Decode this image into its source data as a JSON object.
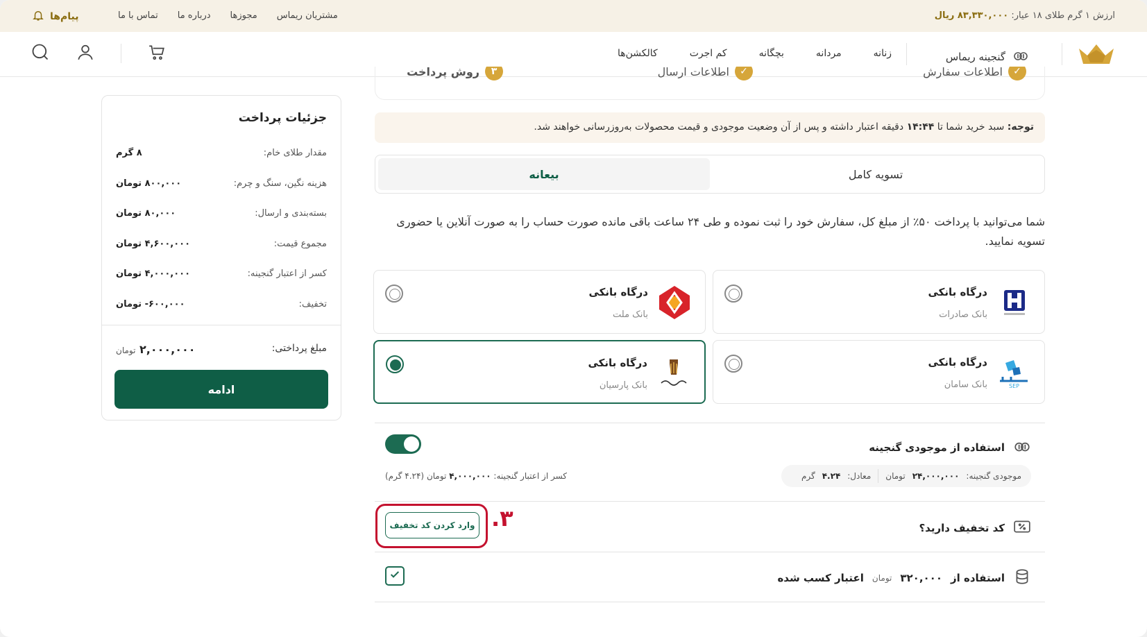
{
  "topbar": {
    "gold_label": "ارزش ۱ گرم طلای ۱۸ عیار:",
    "gold_value": "۸۳,۳۳۰,۰۰۰ ریال",
    "links": [
      "مشتریان ریماس",
      "مجوزها",
      "درباره ما",
      "تماس با ما"
    ],
    "messages": "پیام‌ها"
  },
  "header": {
    "treasury": "گنجینه ریماس",
    "nav": [
      "زنانه",
      "مردانه",
      "بچگانه",
      "کم اجرت",
      "کالکشن‌ها"
    ]
  },
  "steps": [
    {
      "label": "اطلاعات سفارش"
    },
    {
      "label": "اطلاعات ارسال"
    },
    {
      "num": "۳",
      "label": "روش پرداخت"
    }
  ],
  "notice": {
    "lead": "توجه:",
    "text_a": " سبد خرید شما تا ",
    "time": "۱۴:۴۴",
    "text_b": " دقیقه اعتبار داشته و پس از آن وضعیت موجودی و قیمت محصولات به‌روزرسانی خواهند شد."
  },
  "tabs": {
    "full": "تسویه کامل",
    "deposit": "بیعانه"
  },
  "description": "شما می‌توانید با پرداخت ۵۰٪ از  مبلغ کل، سفارش خود را ثبت نموده و طی ۲۴ ساعت باقی مانده صورت حساب را به صورت  آنلاین یا حضوری تسویه نمایید.",
  "gateways": [
    {
      "title": "درگاه بانکی",
      "bank": "بانک صادرات",
      "selected": false
    },
    {
      "title": "درگاه بانکی",
      "bank": "بانک ملت",
      "selected": false
    },
    {
      "title": "درگاه بانکی",
      "bank": "بانک سامان",
      "selected": false
    },
    {
      "title": "درگاه بانکی",
      "bank": "بانک پارسیان",
      "selected": true
    }
  ],
  "treasury_use": {
    "title": "استفاده از موجودی گنجینه",
    "balance_label": "موجودی گنجینه:",
    "balance_value": "۲۴,۰۰۰,۰۰۰",
    "balance_unit": "تومان",
    "equiv_label": "معادل:",
    "equiv_value": "۴.۲۴",
    "equiv_unit": "گرم",
    "deduct_label": "کسر از اعتبار گنجینه:",
    "deduct_value": "۴,۰۰۰,۰۰۰",
    "deduct_unit": "تومان",
    "deduct_grams": "(۴.۲۴ گرم)",
    "enabled": true
  },
  "coupon": {
    "question": "کد تخفیف دارید؟",
    "button": "وارد کردن کد تخفیف",
    "marker": "۳."
  },
  "credit": {
    "prefix": "استفاده از",
    "amount": "۳۲۰,۰۰۰",
    "unit": "تومان",
    "suffix": "اعتبار کسب شده",
    "checked": true
  },
  "summary": {
    "title": "جزئیات پرداخت",
    "rows": [
      {
        "label": "مقدار طلای خام:",
        "value": "۸ گرم"
      },
      {
        "label": "هزینه نگین، سنگ و چرم:",
        "value": "۸۰۰,۰۰۰ تومان"
      },
      {
        "label": "بسته‌بندی و ارسال:",
        "value": "۸۰,۰۰۰ تومان"
      },
      {
        "label": "مجموع قیمت:",
        "value": "۴,۶۰۰,۰۰۰ تومان"
      },
      {
        "label": "کسر از اعتبار گنجینه:",
        "value": "۴,۰۰۰,۰۰۰ تومان"
      },
      {
        "label": "تخفیف:",
        "value": "۶۰۰,۰۰۰- تومان"
      }
    ],
    "total_label": "مبلغ پرداختی:",
    "total_value": "۲,۰۰۰,۰۰۰",
    "total_unit": "تومان",
    "cta": "ادامه"
  },
  "colors": {
    "brand_green": "#0f5e46",
    "gold": "#d6a63a",
    "highlight_red": "#c4122f"
  }
}
